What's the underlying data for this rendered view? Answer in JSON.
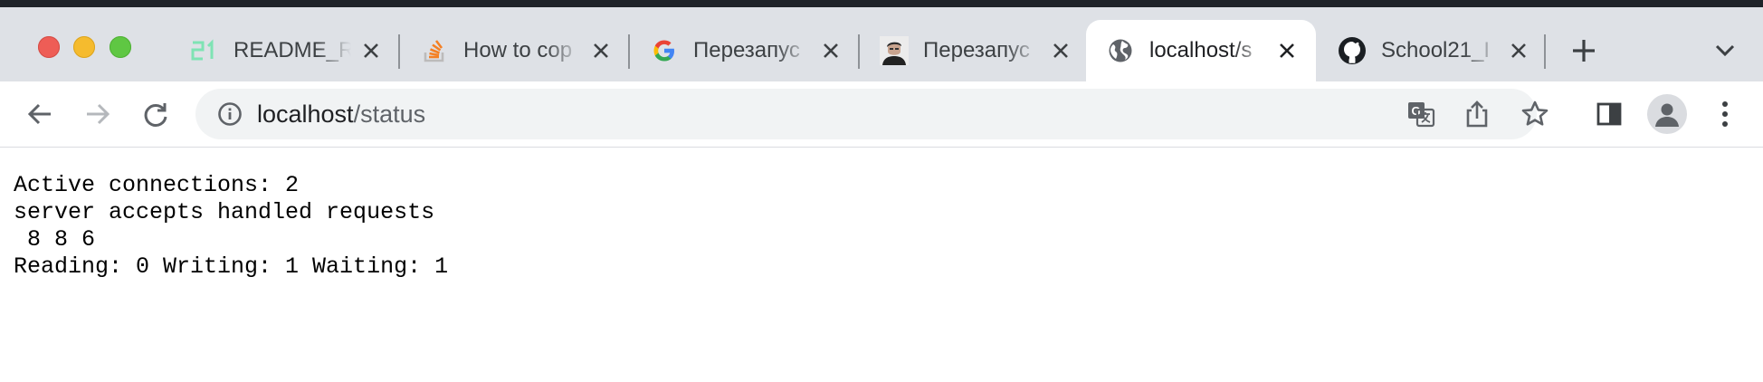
{
  "window": {
    "controls": [
      "close",
      "minimize",
      "zoom"
    ]
  },
  "tabs": [
    {
      "title": "README_R",
      "icon": "school21-logo-icon",
      "active": false
    },
    {
      "title": "How to cop",
      "icon": "stackoverflow-icon",
      "active": false
    },
    {
      "title": "Перезапус",
      "icon": "google-icon",
      "active": false
    },
    {
      "title": "Перезапус",
      "icon": "avatar-photo-icon",
      "active": false
    },
    {
      "title": "localhost/s",
      "icon": "globe-icon",
      "active": true
    },
    {
      "title": "School21_I",
      "icon": "github-icon",
      "active": false
    }
  ],
  "toolbar": {
    "url_host": "localhost",
    "url_path": "/status",
    "icons": [
      "back-icon",
      "forward-icon",
      "reload-icon",
      "site-info-icon",
      "translate-icon",
      "share-icon",
      "bookmark-star-icon",
      "side-panel-icon",
      "profile-icon",
      "more-menu-icon"
    ]
  },
  "page": {
    "lines": [
      "Active connections: 2",
      "server accepts handled requests",
      " 8 8 6",
      "Reading: 0 Writing: 1 Waiting: 1"
    ]
  },
  "colors": {
    "tabstrip": "#dee1e6",
    "topstrip": "#1f2329",
    "close_red": "#ee5d56",
    "minimize_yellow": "#f5bb2e",
    "zoom_green": "#5fc743",
    "omnibox": "#f1f3f4"
  }
}
